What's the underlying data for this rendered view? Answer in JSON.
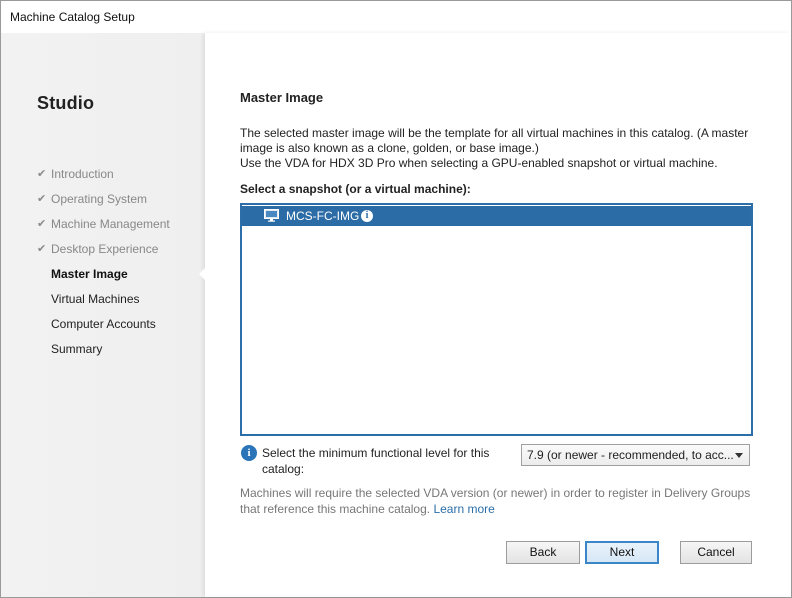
{
  "window": {
    "title": "Machine Catalog Setup"
  },
  "sidebar": {
    "app_name": "Studio",
    "steps": [
      {
        "label": "Introduction",
        "state": "done"
      },
      {
        "label": "Operating System",
        "state": "done"
      },
      {
        "label": "Machine Management",
        "state": "done"
      },
      {
        "label": "Desktop Experience",
        "state": "done"
      },
      {
        "label": "Master Image",
        "state": "active"
      },
      {
        "label": "Virtual Machines",
        "state": "todo"
      },
      {
        "label": "Computer Accounts",
        "state": "todo"
      },
      {
        "label": "Summary",
        "state": "todo"
      }
    ],
    "check_glyph": "✔"
  },
  "main": {
    "heading": "Master Image",
    "description_line1": "The selected master image will be the template for all virtual machines in this catalog. (A master image is also known as a clone, golden, or base image.)",
    "description_line2": "Use the VDA for HDX 3D Pro when selecting a GPU-enabled snapshot or virtual machine.",
    "snapshot_label": "Select a snapshot (or a virtual machine):",
    "snapshots": [
      {
        "name": "MCS-FC-IMG",
        "icon": "monitor-icon",
        "selected": true
      }
    ],
    "info_glyph": "i",
    "functional_level": {
      "label": "Select the minimum functional level for this catalog:",
      "selected": "7.9 (or newer - recommended, to acc..."
    },
    "note_text": "Machines will require the selected VDA version (or newer) in order to register in Delivery Groups that reference this machine catalog.",
    "learn_more": "Learn more"
  },
  "buttons": {
    "back": "Back",
    "next": "Next",
    "cancel": "Cancel"
  },
  "colors": {
    "selection": "#2c6ca6",
    "link": "#2b6ea9",
    "info": "#2b74b8"
  }
}
